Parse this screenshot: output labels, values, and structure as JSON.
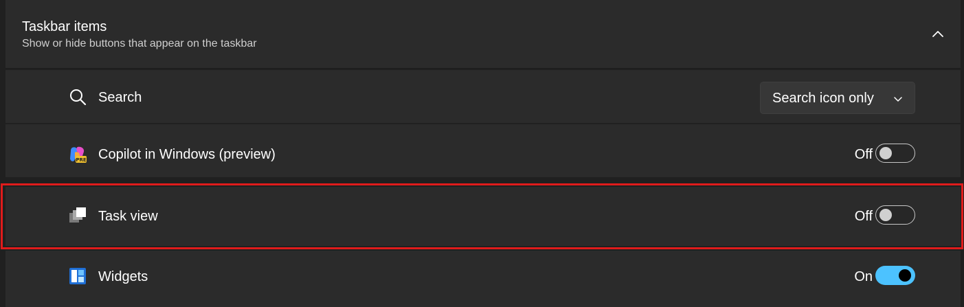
{
  "section": {
    "title": "Taskbar items",
    "subtitle": "Show or hide buttons that appear on the taskbar",
    "expanded": true
  },
  "items": [
    {
      "label": "Search",
      "icon": "search-icon",
      "control": "dropdown",
      "value": "Search icon only"
    },
    {
      "label": "Copilot in Windows (preview)",
      "icon": "copilot-icon",
      "control": "toggle",
      "state_text": "Off",
      "on": false
    },
    {
      "label": "Task view",
      "icon": "task-view-icon",
      "control": "toggle",
      "state_text": "Off",
      "on": false,
      "highlighted": true
    },
    {
      "label": "Widgets",
      "icon": "widgets-icon",
      "control": "toggle",
      "state_text": "On",
      "on": true
    }
  ],
  "colors": {
    "accent": "#4cc2ff",
    "highlight": "#e01b1b",
    "card": "#2b2b2b",
    "background": "#202020"
  }
}
